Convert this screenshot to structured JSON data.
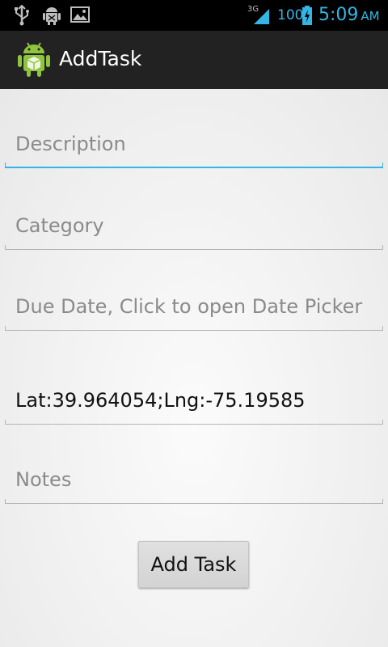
{
  "status_bar": {
    "network": "3G",
    "battery_level": "100",
    "time": "5:09",
    "ampm": "AM",
    "icons": [
      "usb-icon",
      "android-debug-icon",
      "image-icon",
      "signal-icon",
      "battery-charging-icon"
    ]
  },
  "action_bar": {
    "title": "AddTask",
    "icon": "android-app-icon"
  },
  "form": {
    "description": {
      "placeholder": "Description",
      "value": ""
    },
    "category": {
      "placeholder": "Category",
      "value": ""
    },
    "due_date": {
      "placeholder": "Due Date, Click to open Date Picker",
      "value": ""
    },
    "location": {
      "value": "Lat:39.964054;Lng:-75.19585"
    },
    "notes": {
      "placeholder": "Notes",
      "value": ""
    },
    "submit_label": "Add Task"
  },
  "colors": {
    "accent": "#33b5e5",
    "action_bar": "#222222",
    "status_bar": "#000000",
    "hint_text": "#8a8a8a"
  }
}
